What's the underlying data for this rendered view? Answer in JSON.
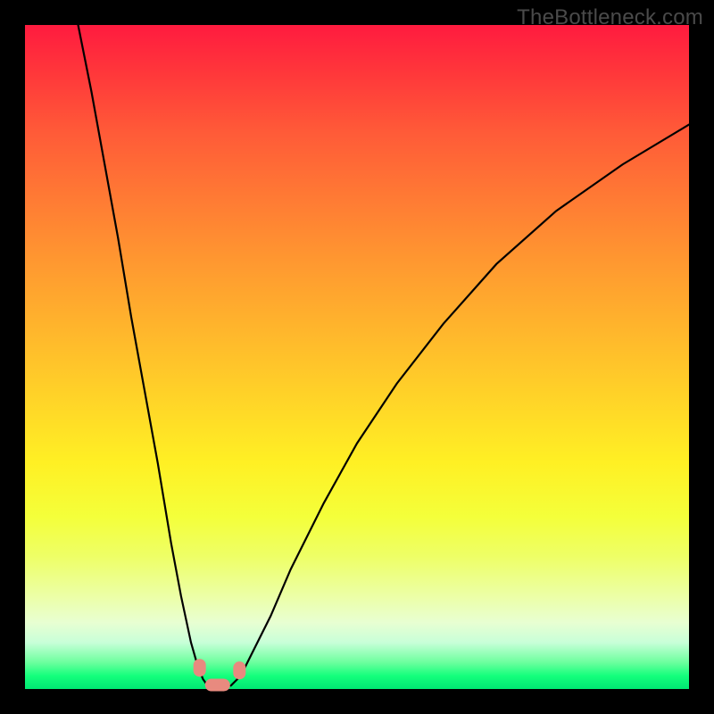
{
  "watermark_text": "TheBottleneck.com",
  "chart_data": {
    "type": "line",
    "title": "",
    "xlabel": "",
    "ylabel": "",
    "xlim": [
      0,
      100
    ],
    "ylim": [
      0,
      100
    ],
    "series": [
      {
        "name": "left-curve",
        "x": [
          8,
          10,
          12,
          14,
          16,
          18,
          20,
          22,
          23.5,
          25,
          26,
          26.8,
          27.5
        ],
        "values": [
          100,
          90,
          79,
          68,
          56,
          45,
          34,
          22,
          14,
          7,
          3.5,
          1.5,
          0.5
        ]
      },
      {
        "name": "right-curve",
        "x": [
          31,
          32.5,
          34,
          37,
          40,
          45,
          50,
          56,
          63,
          71,
          80,
          90,
          100
        ],
        "values": [
          0.5,
          2,
          5,
          11,
          18,
          28,
          37,
          46,
          55,
          64,
          72,
          79,
          85
        ]
      }
    ],
    "annotations": {
      "markers": [
        {
          "name": "left-entry-marker",
          "x": 26.3,
          "y": 3.2
        },
        {
          "name": "right-entry-marker",
          "x": 32.3,
          "y": 2.8
        },
        {
          "name": "trough-marker",
          "x": 29.0,
          "y": 0.6
        }
      ]
    },
    "background": {
      "gradient_top": "#ff1b3f",
      "gradient_bottom": "#00e873"
    }
  }
}
